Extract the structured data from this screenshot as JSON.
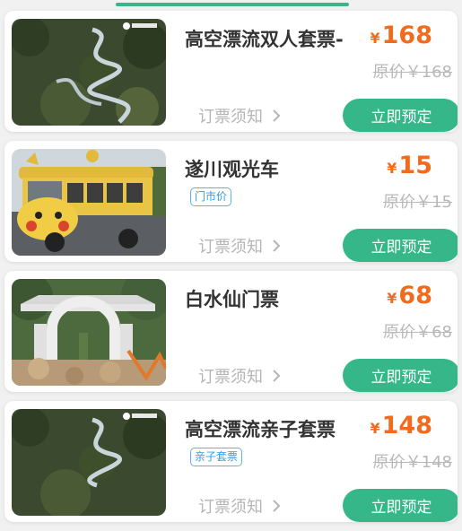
{
  "products": [
    {
      "title": "高空漂流双人套票-",
      "badge": "",
      "currency": "¥",
      "price": "168",
      "original_price": "原价￥168",
      "notice": "订票须知",
      "book": "立即预定",
      "image": "rafting-track-photo"
    },
    {
      "title": "遂川观光车",
      "badge": "门市价",
      "currency": "¥",
      "price": "15",
      "original_price": "原价￥15",
      "notice": "订票须知",
      "book": "立即预定",
      "image": "sightseeing-cart-photo"
    },
    {
      "title": "白水仙门票",
      "badge": "",
      "currency": "¥",
      "price": "68",
      "original_price": "原价￥68",
      "notice": "订票须知",
      "book": "立即预定",
      "image": "stone-gate-photo"
    },
    {
      "title": "高空漂流亲子套票",
      "badge": "亲子套票",
      "currency": "¥",
      "price": "148",
      "original_price": "原价￥148",
      "notice": "订票须知",
      "book": "立即预定",
      "image": "rafting-track-photo"
    }
  ],
  "colors": {
    "accent": "#36b78a",
    "price": "#f26a1b",
    "badge": "#2e9fe8"
  }
}
